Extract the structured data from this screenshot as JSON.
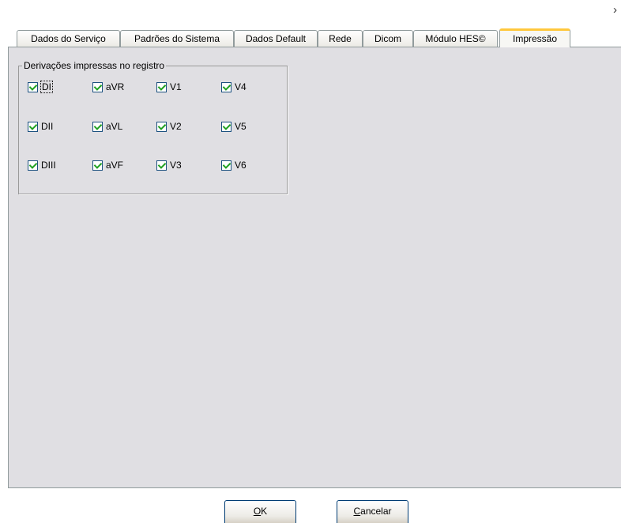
{
  "window": {
    "close_glyph": "›"
  },
  "tabs": [
    {
      "label": "Dados do Serviço",
      "active": false
    },
    {
      "label": "Padrões do Sistema",
      "active": false
    },
    {
      "label": "Dados Default",
      "active": false
    },
    {
      "label": "Rede",
      "active": false
    },
    {
      "label": "Dicom",
      "active": false
    },
    {
      "label": "Módulo HES©",
      "active": false
    },
    {
      "label": "Impressão",
      "active": true
    }
  ],
  "group": {
    "title": "Derivações impressas no registro",
    "leads": [
      {
        "label": "DI",
        "checked": true,
        "focused": true
      },
      {
        "label": "aVR",
        "checked": true
      },
      {
        "label": "V1",
        "checked": true
      },
      {
        "label": "V4",
        "checked": true
      },
      {
        "label": "DII",
        "checked": true
      },
      {
        "label": "aVL",
        "checked": true
      },
      {
        "label": "V2",
        "checked": true
      },
      {
        "label": "V5",
        "checked": true
      },
      {
        "label": "DIII",
        "checked": true
      },
      {
        "label": "aVF",
        "checked": true
      },
      {
        "label": "V3",
        "checked": true
      },
      {
        "label": "V6",
        "checked": true
      }
    ]
  },
  "buttons": {
    "ok": {
      "mnemonic": "O",
      "rest": "K"
    },
    "cancel": {
      "mnemonic": "C",
      "rest": "ancelar"
    }
  },
  "colors": {
    "active_tab_accent": "#ffc83c",
    "panel_bg": "#e0dfe3",
    "check_mark": "#21a121"
  }
}
